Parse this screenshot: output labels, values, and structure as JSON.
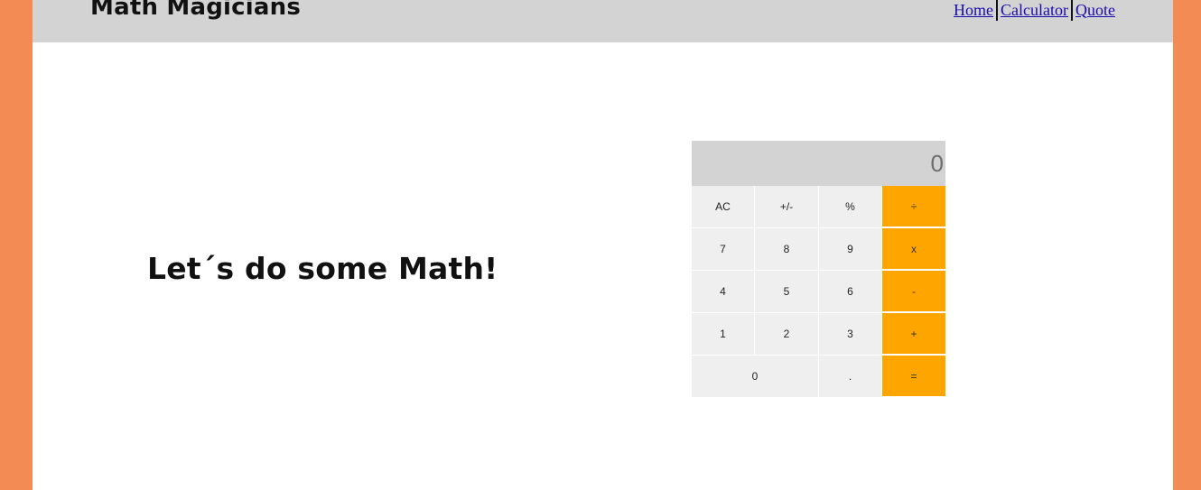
{
  "header": {
    "brand": "Math Magicians",
    "nav": [
      {
        "label": "Home"
      },
      {
        "label": "Calculator"
      },
      {
        "label": "Quote"
      }
    ]
  },
  "main": {
    "heading": "Let´s do some Math!"
  },
  "calculator": {
    "display": "0",
    "keys": {
      "ac": "AC",
      "sign": "+/-",
      "percent": "%",
      "divide": "÷",
      "seven": "7",
      "eight": "8",
      "nine": "9",
      "multiply": "x",
      "four": "4",
      "five": "5",
      "six": "6",
      "minus": "-",
      "one": "1",
      "two": "2",
      "three": "3",
      "plus": "+",
      "zero": "0",
      "dot": ".",
      "equals": "="
    }
  },
  "colors": {
    "side_background": "#f28b54",
    "header_background": "#d3d3d3",
    "operator_accent": "#ffa500",
    "key_background": "#efefef"
  }
}
